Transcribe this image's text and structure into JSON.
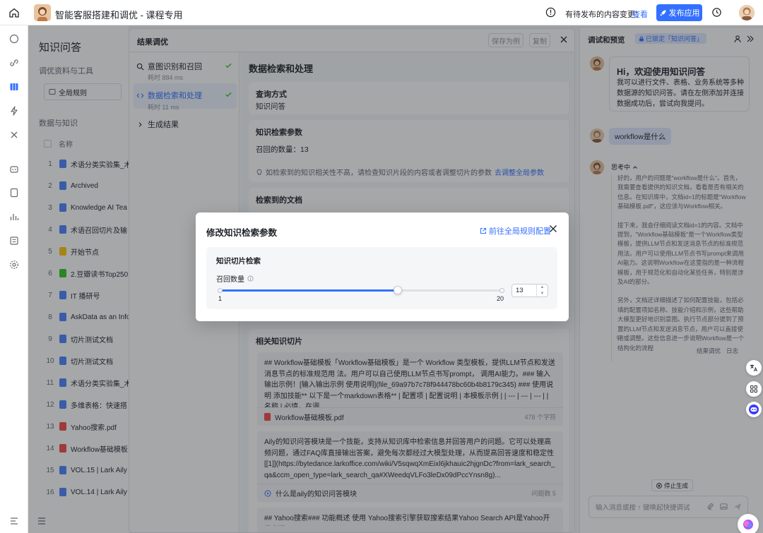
{
  "app": {
    "title": "智能客服搭建和调优 - 课程专用",
    "pending_text": "有待发布的内容变更：",
    "pending_link": "查看",
    "publish_label": "发布应用"
  },
  "left_pane": {
    "heading": "知识问答",
    "tuning_section": "调优资料与工具",
    "global_rules_button": "全局规则",
    "data_section": "数据与知识",
    "name_header": "名称",
    "rows": [
      {
        "num": "1",
        "name": "术语分类实验集_术",
        "color": "#4e83fd"
      },
      {
        "num": "2",
        "name": "Archived",
        "color": "#4e83fd"
      },
      {
        "num": "3",
        "name": "Knowledge AI Tea",
        "color": "#4e83fd"
      },
      {
        "num": "4",
        "name": "术语召回切片及输",
        "color": "#4e83fd"
      },
      {
        "num": "5",
        "name": "开始节点",
        "color": "#ffc60a"
      },
      {
        "num": "6",
        "name": "2.豆瓣读书Top250",
        "color": "#34c724"
      },
      {
        "num": "7",
        "name": "IT 播研号",
        "color": "#4e83fd"
      },
      {
        "num": "8",
        "name": "AskData as an Info",
        "color": "#4e83fd"
      },
      {
        "num": "9",
        "name": "切片测试文档",
        "color": "#4e83fd"
      },
      {
        "num": "10",
        "name": "切片测试文档",
        "color": "#4e83fd"
      },
      {
        "num": "11",
        "name": "术语分类实验集_术",
        "color": "#4e83fd"
      },
      {
        "num": "12",
        "name": "多维表格：快速搭",
        "color": "#4e83fd"
      },
      {
        "num": "13",
        "name": "Yahoo搜索.pdf",
        "color": "#f54a45"
      },
      {
        "num": "14",
        "name": "Workflow基础模板",
        "color": "#f54a45"
      },
      {
        "num": "15",
        "name": "VOL.15 | Lark Aily",
        "color": "#4e83fd"
      },
      {
        "num": "16",
        "name": "VOL.14 | Lark Aily",
        "color": "#4e83fd"
      }
    ]
  },
  "panel": {
    "title": "结果调优",
    "save_example": "保存为例",
    "copy": "复制",
    "steps": [
      {
        "label": "意图识别和召回",
        "time": "耗时 884 ms"
      },
      {
        "label": "数据检索和处理",
        "time": "耗时 11 ms"
      },
      {
        "label": "生成结果"
      }
    ],
    "content_title": "数据检索和处理",
    "query_card": {
      "heading": "查询方式",
      "value": "知识问答"
    },
    "params_card": {
      "heading": "知识检索参数",
      "recall": "召回的数量：13",
      "tip": "如检索到的知识相关性不高，请检查知识片段的内容或者调整切片的参数",
      "tip_link": "去调整全局参数"
    },
    "retrieved_heading": "检索到的文档",
    "chunks_heading": "相关知识切片",
    "chunks": [
      {
        "text": "## Workflow基础模板「Workflow基础模板」是一个 Workflow 类型模板，提供LLM节点和发送消息节点的标准规范用 法。用户可以自己使用LLM节点书写prompt， 调用AI能力。### 输入输出示例！[输入输出示例 使用说明](file_69a97b7c78f944478bc60b4b8179c345) ### 使用说明 添加技能** 以下是一个markdown表格** | 配置项 | 配置说明 | 本模板示例 | | --- | --- | --- | | 名称 | 必填。在调...",
        "source": "Workflow基础模板.pdf",
        "meta": "478 个字符"
      },
      {
        "text": "Aily的知识问答模块是一个技能，支持从知识库中检索信息并回答用户的问题。它可以处理高频问题，通过FAQ库直接输出答案，避免每次都经过大模型处理，从而提高回答速度和稳定性[[1]](https://bytedance.larkoffice.com/wiki/V5sqwqXmEixl6jkhauic2hjgnDc?from=lark_search_qa&ccm_open_type=lark_search_qa#XWeedqVLFo3leDx09dPccYnsn8g)...",
        "source": "什么是aily的知识问答模块",
        "meta": "问题数 5"
      },
      {
        "text": "## Yahoo搜索### 功能概述 使用 Yahoo搜索引擎获取搜索结果Yahoo Search API是Yahoo开发者网"
      }
    ]
  },
  "modal": {
    "title": "修改知识检索参数",
    "link": "前往全局规则配置",
    "section": "知识切片检索",
    "field_label": "召回数量",
    "min": "1",
    "max": "20",
    "value": "13",
    "fraction": 0.63
  },
  "right": {
    "title": "调试和预览",
    "badge": "已锁定「知识问答」",
    "greeting_title": "Hi，欢迎使用知识问答",
    "greeting_text": "我可以进行文件、表格、业务系统等多种数据源的知识问答。请在左侧添加并连接数据成功后，尝试向我提问。",
    "user_msg": "workflow是什么",
    "thinking": "思考中",
    "think_paras": [
      "好的，用户的问题是\"workflow是什么\"。首先，我需要查看提供的知识文档，看看是否有相关的信息。在知识库中，文档id=1的标题是\"Workflow基础模板.pdf\"，这应该与Workflow相关。",
      "接下来，我会仔细阅读文档id=1的内容。文档中提到，\"Workflow基础模板\"是一个Workflow类型模板，提供LLM节点和发送消息节点的标准规范用法。用户可以使用LLM节点书写prompt来调用AI能力。这说明Workflow在这里指的是一种流程模板，用于规范化和自动化某些任务，特别是涉及AI的部分。",
      "另外，文档还详细描述了如何配置技能，包括必填的配置项如名称、技能介绍和示例，这些帮助大模型更好地识别意图。执行节点部分提到了预置的LLM节点和发送消息节点，用户可以直接使用或调整。这些信息进一步说明Workflow是一个结构化的流程"
    ],
    "tune_action": "结果调优",
    "log_action": "日志",
    "stop_label": "停止生成",
    "input_placeholder": "输入消息或按 ↑ 键唤起快捷调试"
  },
  "colors": {
    "accent": "#3370ff",
    "success": "#34c724",
    "pdf": "#f54a45"
  }
}
